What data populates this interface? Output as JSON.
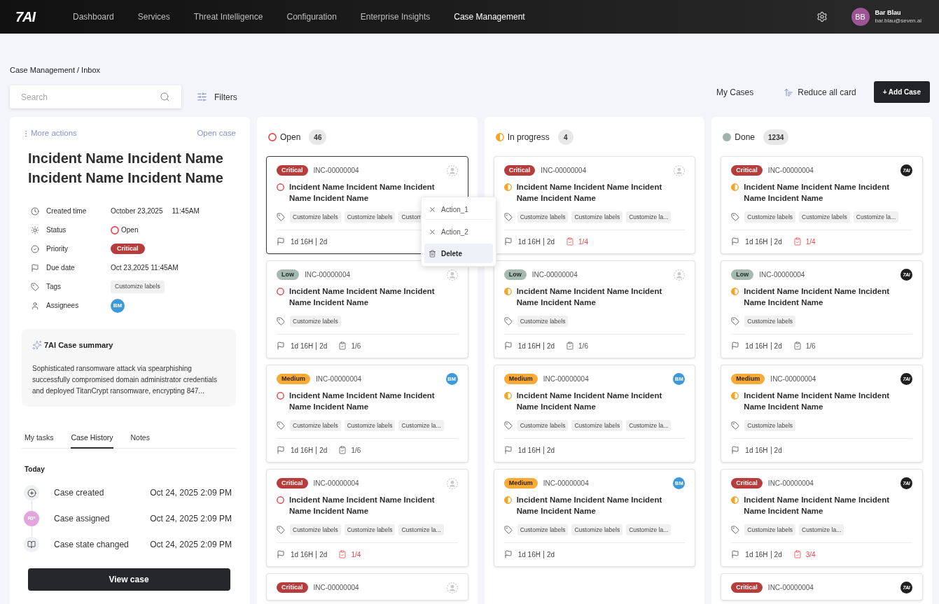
{
  "nav": {
    "logo": "7AI",
    "items": [
      {
        "label": "Dashboard",
        "selected": false
      },
      {
        "label": "Services",
        "selected": false
      },
      {
        "label": "Threat Intelligence",
        "selected": false
      },
      {
        "label": "Configuration",
        "selected": false
      },
      {
        "label": "Enterprise Insights",
        "selected": false
      },
      {
        "label": "Case Management",
        "selected": true
      }
    ],
    "user": {
      "initials": "BB",
      "name": "Bar Blau",
      "email": "bar.blau@seven.ai"
    }
  },
  "breadcrumb": "Case Management / Inbox",
  "toolbar": {
    "search": {
      "placeholder": "Search"
    },
    "filters": "Filters",
    "my_cases": "My Cases",
    "reduce": "Reduce all card",
    "add_case": "+ Add Case"
  },
  "detail": {
    "more_actions": "More actions",
    "open_case": "Open case",
    "title": "Incident Name Incident Name Incident Name Incident Name",
    "fields": [
      {
        "kind": "created",
        "label": "Created time",
        "date": "October 23,2025",
        "time": "11:45AM"
      },
      {
        "kind": "status",
        "label": "Status",
        "icon": {
          "kind": "open"
        },
        "value": "Open"
      },
      {
        "kind": "priority",
        "label": "Priority",
        "badge": {
          "kind": "critical",
          "label": "Critical"
        }
      },
      {
        "kind": "due",
        "label": "Due date",
        "value": "Oct 23,2025 11:45AM"
      },
      {
        "kind": "tags",
        "label": "Tags",
        "tags": [
          "Customize labels"
        ]
      },
      {
        "kind": "assignees",
        "label": "Assignees",
        "assignees": [
          "BM"
        ]
      }
    ],
    "summary": {
      "title": "7AI Case summary",
      "text": "Sophisticated ransomware attack via spearphishing successfully compromised domain administrator credentials and deployed TitanCrypt ransomware, encrypting 847..."
    },
    "tabs": [
      {
        "label": "My tasks",
        "selected": false
      },
      {
        "label": "Case History",
        "selected": true
      },
      {
        "label": "Notes",
        "selected": false
      }
    ],
    "history": {
      "group": "Today",
      "events": [
        {
          "kind": "created",
          "label": "Case created",
          "time": "Oct 24, 2025 2:09 PM"
        },
        {
          "kind": "assigned",
          "initials": "RP",
          "label": "Case assigned",
          "time": "Oct 24, 2025 2:09 PM"
        },
        {
          "kind": "state",
          "label": "Case state changed",
          "time": "Oct 24, 2025 2:09 PM"
        }
      ]
    },
    "view_case": "View case"
  },
  "columns": [
    {
      "icon": {
        "kind": "open"
      },
      "label": "Open",
      "count": "46",
      "cards": [
        {
          "priority": {
            "kind": "critical",
            "label": "Critical"
          },
          "id": "INC-00000004",
          "assignee": {
            "kind": "none"
          },
          "status_icon": {
            "kind": "open"
          },
          "title": "Incident Name Incident Name Incident Name Incident Name",
          "tags": [
            "Customize labels",
            "Customize labels",
            "Custom"
          ],
          "elapsed": "1d 16H",
          "due": "2d",
          "selected": true,
          "menu": [
            {
              "kind": "dismiss",
              "label": "Action_1",
              "highlighted": false
            },
            {
              "kind": "dismiss",
              "label": "Action_2",
              "highlighted": false
            },
            {
              "kind": "delete",
              "label": "Delete",
              "highlighted": true
            }
          ]
        },
        {
          "priority": {
            "kind": "low",
            "label": "Low"
          },
          "id": "INC-00000004",
          "assignee": {
            "kind": "none"
          },
          "status_icon": {
            "kind": "open"
          },
          "title": "Incident Name Incident Name Incident Name Incident Name",
          "tags": [
            "Customize labels"
          ],
          "elapsed": "1d 16H",
          "due": "2d",
          "subtasks": {
            "text": "1/6",
            "overdue": false
          },
          "selected": false
        },
        {
          "priority": {
            "kind": "medium",
            "label": "Medium"
          },
          "id": "INC-00000004",
          "assignee": {
            "kind": "avatar",
            "initials": "BM"
          },
          "status_icon": {
            "kind": "open"
          },
          "title": "Incident Name Incident Name Incident Name Incident Name",
          "tags": [
            "Customize labels",
            "Customize labels",
            "Customize la..."
          ],
          "elapsed": "1d 16H",
          "due": "2d",
          "subtasks": {
            "text": "1/6",
            "overdue": false
          },
          "selected": false
        },
        {
          "priority": {
            "kind": "critical",
            "label": "Critical"
          },
          "id": "INC-00000004",
          "assignee": {
            "kind": "none"
          },
          "status_icon": {
            "kind": "open"
          },
          "title": "Incident Name Incident Name Incident Name Incident Name",
          "tags": [
            "Customize labels",
            "Customize labels",
            "Customize la..."
          ],
          "elapsed": "1d 16H",
          "due": "2d",
          "subtasks": {
            "text": "1/4",
            "overdue": true
          },
          "selected": false
        },
        {
          "priority": {
            "kind": "critical",
            "label": "Critical"
          },
          "id": "INC-00000004",
          "assignee": {
            "kind": "none"
          },
          "selected": false
        }
      ]
    },
    {
      "icon": {
        "kind": "in_progress"
      },
      "label": "In progress",
      "count": "4",
      "cards": [
        {
          "priority": {
            "kind": "critical",
            "label": "Critical"
          },
          "id": "INC-00000004",
          "assignee": {
            "kind": "none"
          },
          "status_icon": {
            "kind": "in_progress"
          },
          "title": "Incident Name Incident Name Incident Name Incident Name",
          "tags": [
            "Customize labels",
            "Customize labels",
            "Customize la..."
          ],
          "elapsed": "1d 16H",
          "due": "2d",
          "subtasks": {
            "text": "1/4",
            "overdue": true
          },
          "selected": false
        },
        {
          "priority": {
            "kind": "low",
            "label": "Low"
          },
          "id": "INC-00000004",
          "assignee": {
            "kind": "none"
          },
          "status_icon": {
            "kind": "in_progress"
          },
          "title": "Incident Name Incident Name Incident Name Incident Name",
          "tags": [
            "Customize labels"
          ],
          "elapsed": "1d 16H",
          "due": "2d",
          "subtasks": {
            "text": "1/6",
            "overdue": false
          },
          "selected": false
        },
        {
          "priority": {
            "kind": "medium",
            "label": "Medium"
          },
          "id": "INC-00000004",
          "assignee": {
            "kind": "avatar",
            "initials": "BM"
          },
          "status_icon": {
            "kind": "in_progress"
          },
          "title": "Incident Name Incident Name Incident Name Incident Name",
          "tags": [
            "Customize labels",
            "Customize labels",
            "Customize la..."
          ],
          "elapsed": "1d 16H",
          "due": "2d",
          "selected": false
        },
        {
          "priority": {
            "kind": "medium",
            "label": "Medium"
          },
          "id": "INC-00000004",
          "assignee": {
            "kind": "avatar",
            "initials": "BM"
          },
          "status_icon": {
            "kind": "in_progress"
          },
          "title": "Incident Name Incident Name Incident Name Incident Name",
          "tags": [
            "Customize labels",
            "Customize labels",
            "Customize la..."
          ],
          "elapsed": "1d 16H",
          "due": "2d",
          "selected": false
        }
      ]
    },
    {
      "icon": {
        "kind": "done"
      },
      "label": "Done",
      "count": "1234",
      "cards": [
        {
          "priority": {
            "kind": "critical",
            "label": "Critical"
          },
          "id": "INC-00000004",
          "assignee": {
            "kind": "logo",
            "text": "7AI"
          },
          "status_icon": {
            "kind": "in_progress"
          },
          "title": "Incident Name Incident Name Incident Name Incident Name",
          "tags": [
            "Customize labels",
            "Customize labels",
            "Customize la..."
          ],
          "elapsed": "1d 16H",
          "due": "2d",
          "subtasks": {
            "text": "1/4",
            "overdue": true
          },
          "selected": false
        },
        {
          "priority": {
            "kind": "low",
            "label": "Low"
          },
          "id": "INC-00000004",
          "assignee": {
            "kind": "logo",
            "text": "7AI"
          },
          "status_icon": {
            "kind": "in_progress"
          },
          "title": "Incident Name Incident Name Incident Name Incident Name",
          "tags": [
            "Customize labels"
          ],
          "elapsed": "1d 16H",
          "due": "2d",
          "subtasks": {
            "text": "1/6",
            "overdue": false
          },
          "selected": false
        },
        {
          "priority": {
            "kind": "medium",
            "label": "Medium"
          },
          "id": "INC-00000004",
          "assignee": {
            "kind": "logo",
            "text": "7AI"
          },
          "status_icon": {
            "kind": "in_progress"
          },
          "title": "Incident Name Incident Name Incident Name Incident Name",
          "tags": [
            "Customize labels"
          ],
          "elapsed": "1d 16H",
          "due": "2d",
          "selected": false
        },
        {
          "priority": {
            "kind": "critical",
            "label": "Critical"
          },
          "id": "INC-00000004",
          "assignee": {
            "kind": "logo",
            "text": "7AI"
          },
          "status_icon": {
            "kind": "in_progress"
          },
          "title": "Incident Name Incident Name Incident Name Incident Name",
          "tags": [
            "Customize labels",
            "Customize la..."
          ],
          "elapsed": "1d 16H",
          "due": "2d",
          "subtasks": {
            "text": "3/4",
            "overdue": true
          },
          "selected": false
        },
        {
          "priority": {
            "kind": "critical",
            "label": "Critical"
          },
          "id": "INC-00000004",
          "assignee": {
            "kind": "logo",
            "text": "7AI"
          },
          "selected": false
        }
      ]
    }
  ]
}
